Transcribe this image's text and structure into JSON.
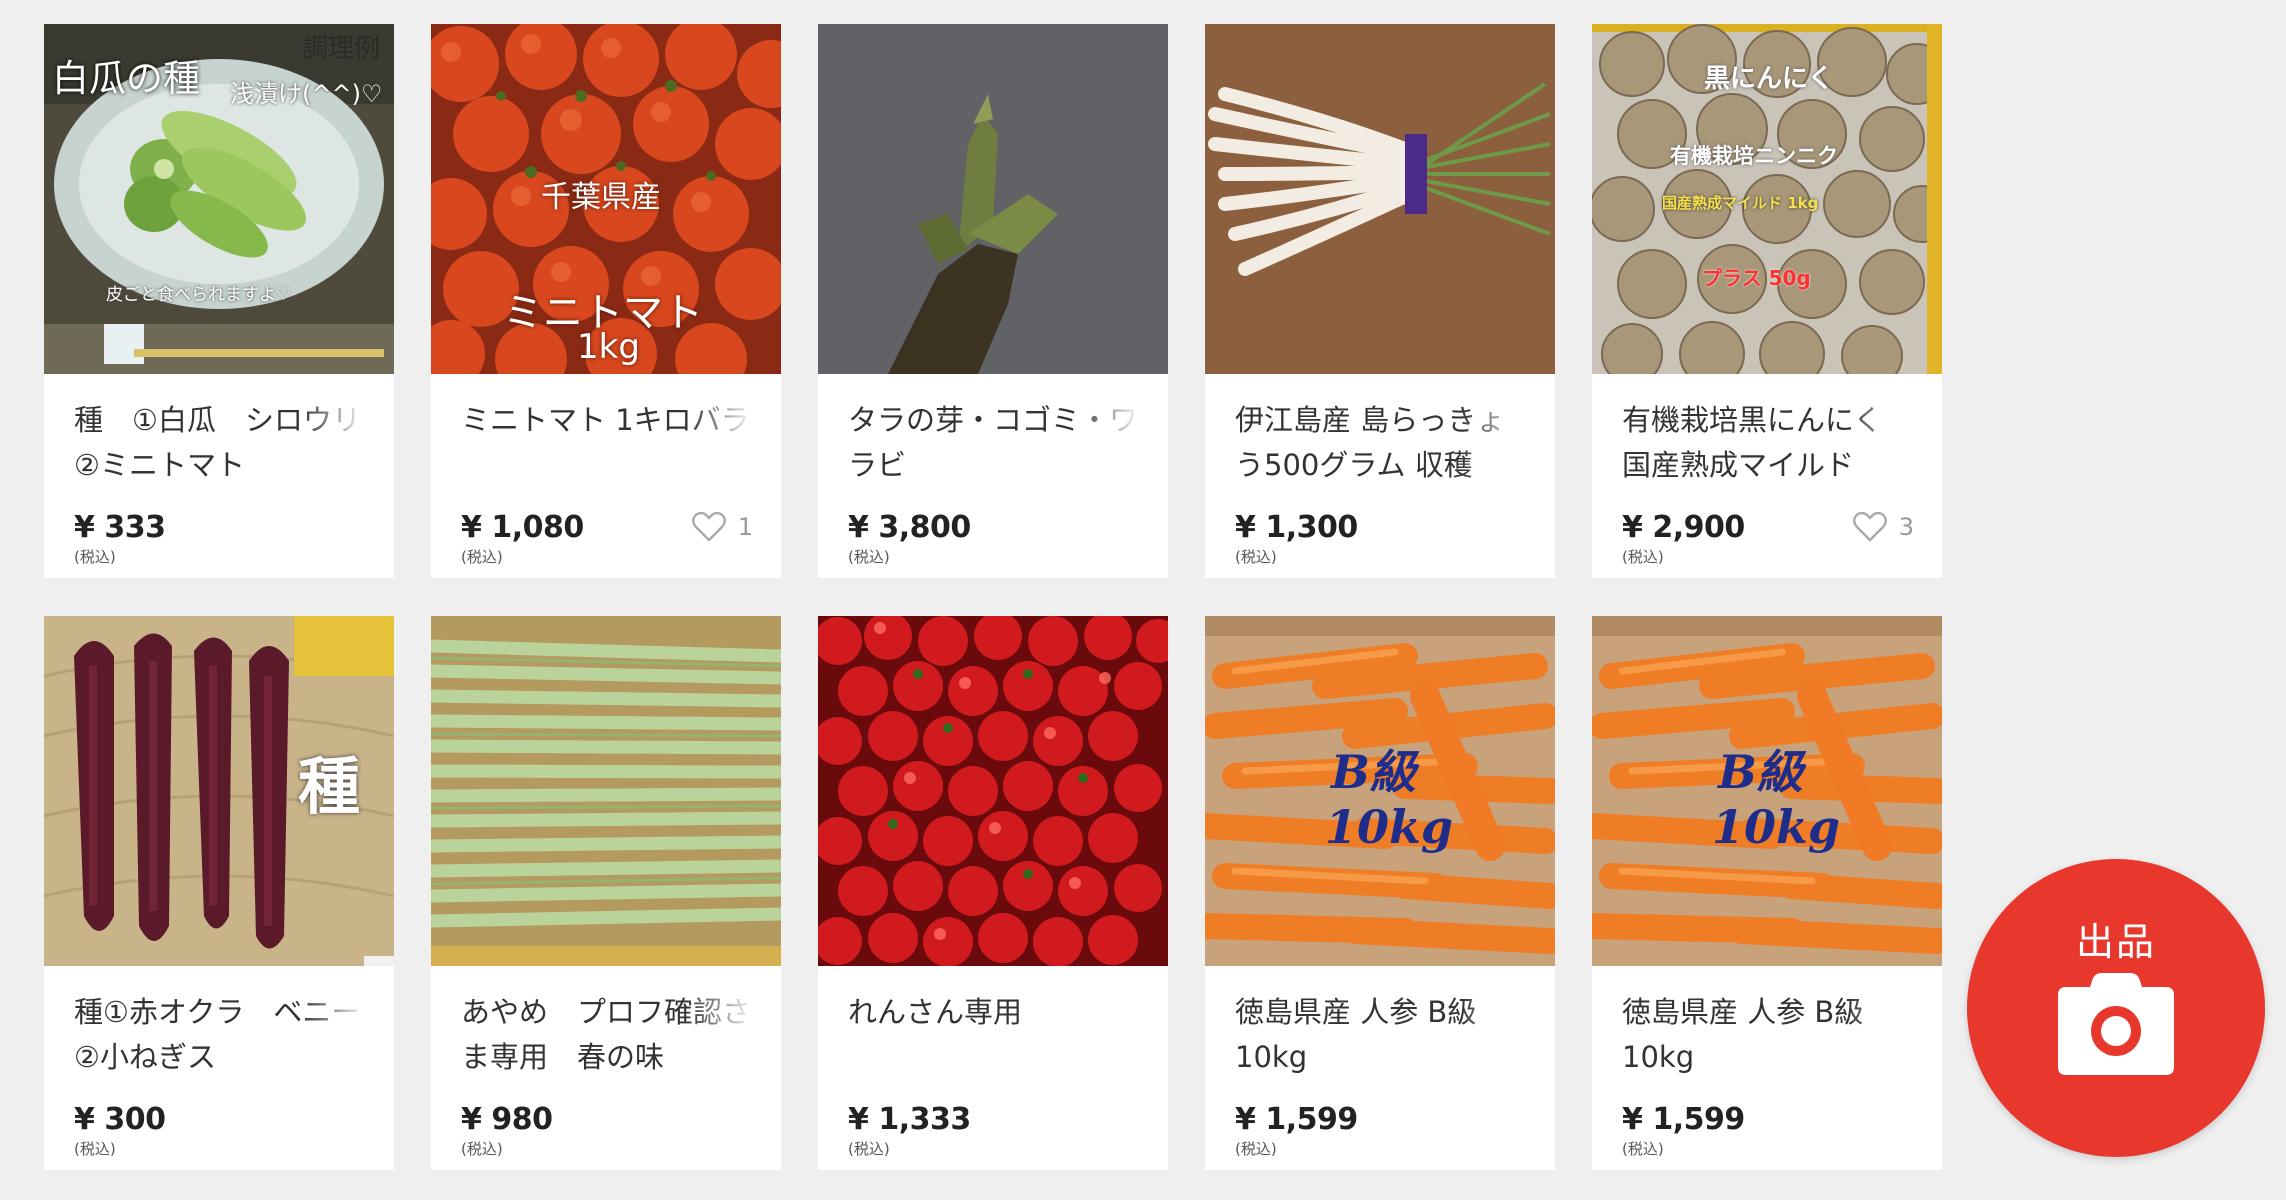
{
  "items": [
    {
      "title": "種　①白瓜　シロウリ　②ミニトマト",
      "price": "¥ 333",
      "tax": "(税込)",
      "likes": "",
      "image_text": [
        "白瓜の種",
        "調理例",
        "浅漬け(^^)♡",
        "皮ごと食べられますよ♡"
      ]
    },
    {
      "title": "ミニトマト 1キロバラ",
      "price": "¥ 1,080",
      "tax": "(税込)",
      "likes": "1",
      "image_text": [
        "千葉県産",
        "ミニトマト",
        "1kg"
      ]
    },
    {
      "title": "タラの芽・コゴミ・ワラビ",
      "price": "¥ 3,800",
      "tax": "(税込)",
      "likes": "",
      "image_text": []
    },
    {
      "title": "伊江島産 島らっきょう500グラム 収穫",
      "price": "¥ 1,300",
      "tax": "(税込)",
      "likes": "",
      "image_text": []
    },
    {
      "title": "有機栽培黒にんにく 国産熟成マイルド",
      "price": "¥ 2,900",
      "tax": "(税込)",
      "likes": "3",
      "image_text": [
        "黒にんにく",
        "有機栽培ニンニク",
        "国産熟成マイルド 1kg",
        "プラス 50g"
      ]
    },
    {
      "title": "種①赤オクラ　ベニー　②小ねぎス",
      "price": "¥ 300",
      "tax": "(税込)",
      "likes": "",
      "image_text": [
        "種"
      ]
    },
    {
      "title": "あやめ　プロフ確認さま専用　春の味",
      "price": "¥ 980",
      "tax": "(税込)",
      "likes": "",
      "image_text": []
    },
    {
      "title": "れんさん専用",
      "price": "¥ 1,333",
      "tax": "(税込)",
      "likes": "",
      "image_text": []
    },
    {
      "title": "徳島県産 人参 B級 10kg",
      "price": "¥ 1,599",
      "tax": "(税込)",
      "likes": "",
      "image_text": [
        "B級",
        "10kg"
      ]
    },
    {
      "title": "徳島県産 人参 B級 10kg",
      "price": "¥ 1,599",
      "tax": "(税込)",
      "likes": "",
      "image_text": [
        "B級",
        "10kg"
      ]
    }
  ],
  "sell_button": {
    "label": "出品",
    "icon": "camera-icon",
    "color": "#e8382e"
  },
  "colors": {
    "background": "#efefef",
    "card": "#ffffff",
    "price": "#222222",
    "heart": "#aaaaaa"
  }
}
